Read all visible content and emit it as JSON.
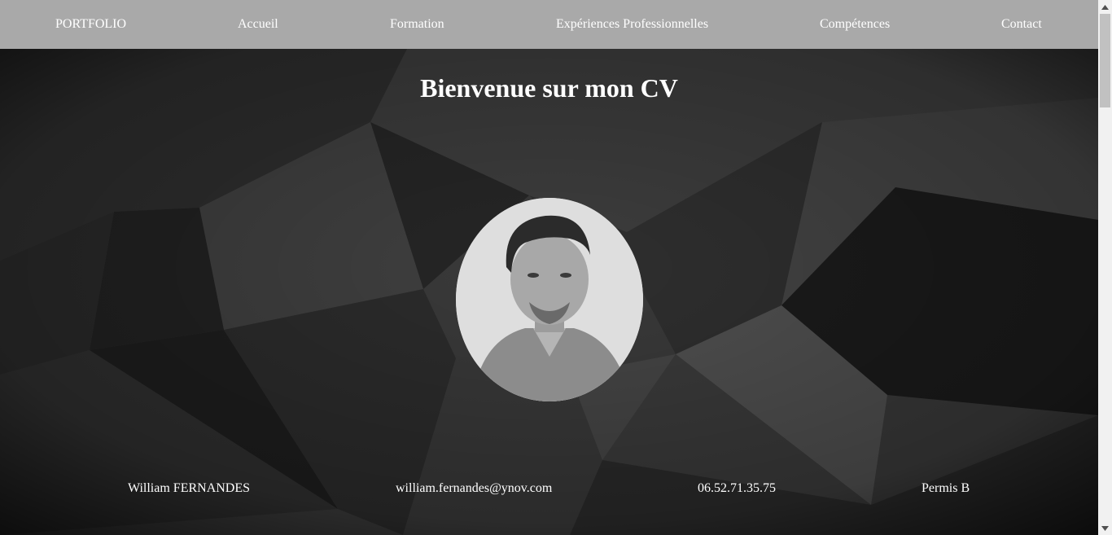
{
  "nav": {
    "brand": "PORTFOLIO",
    "items": [
      {
        "label": "Accueil"
      },
      {
        "label": "Formation"
      },
      {
        "label": "Expériences Professionnelles"
      },
      {
        "label": "Compétences"
      },
      {
        "label": "Contact"
      }
    ]
  },
  "hero": {
    "title": "Bienvenue sur mon CV"
  },
  "contact": {
    "name": "William FERNANDES",
    "email": "william.fernandes@ynov.com",
    "phone": "06.52.71.35.75",
    "license": "Permis B"
  },
  "colors": {
    "navbar_bg": "#a9a9a9",
    "text": "#ffffff",
    "background": "#1a1a1a"
  },
  "icons": {
    "profile_photo": "avatar-photo",
    "scroll_up": "caret-up-icon",
    "scroll_down": "caret-down-icon"
  }
}
